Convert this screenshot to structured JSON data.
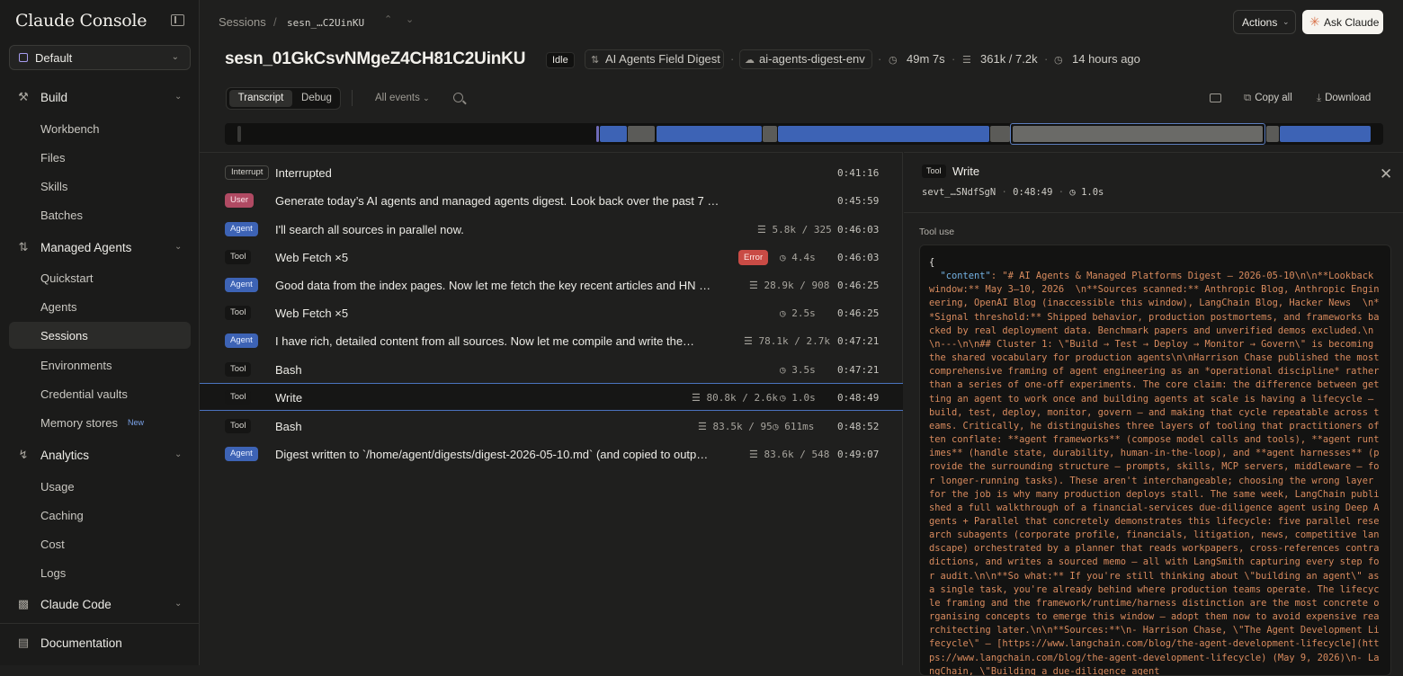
{
  "sidebar": {
    "brand": "Claude Console",
    "workspace": "Default",
    "sections": [
      {
        "label": "Build",
        "icon": "hammer-icon"
      },
      {
        "label": "Managed Agents",
        "icon": "agents-icon"
      },
      {
        "label": "Analytics",
        "icon": "bolt-icon"
      },
      {
        "label": "Claude Code",
        "icon": "terminal-icon"
      }
    ],
    "build_items": [
      "Workbench",
      "Files",
      "Skills",
      "Batches"
    ],
    "agents_items": [
      "Quickstart",
      "Agents",
      "Sessions",
      "Environments",
      "Credential vaults",
      "Memory stores"
    ],
    "memory_badge": "New",
    "analytics_items": [
      "Usage",
      "Caching",
      "Cost",
      "Logs"
    ],
    "documentation": "Documentation",
    "active_item": "Sessions"
  },
  "topbar": {
    "crumb_root": "Sessions",
    "crumb_current": "sesn_…C2UinKU",
    "actions_label": "Actions",
    "ask_label": "Ask Claude"
  },
  "session": {
    "id": "sesn_01GkCsvNMgeZ4CH81C2UinKU",
    "status": "Idle",
    "agent_name": "AI Agents Field Digest",
    "environment": "ai-agents-digest-env",
    "duration": "49m 7s",
    "tokens": "361k / 7.2k",
    "when": "14 hours ago"
  },
  "toolbar": {
    "tabs": [
      "Transcript",
      "Debug"
    ],
    "filter": "All events",
    "copy_all": "Copy all",
    "download": "Download"
  },
  "timeline": {
    "colors": {
      "agent": "#3d63b5",
      "tool": "#5b5b58",
      "interrupt": "#6e6ab8"
    }
  },
  "events": [
    {
      "tag": "Interrupt",
      "kind": "interrupt",
      "text": "Interrupted",
      "tokens": "",
      "duration": "",
      "time": "0:41:16"
    },
    {
      "tag": "User",
      "kind": "user",
      "text": "Generate today’s AI agents and managed agents digest. Look back over the past 7 …",
      "tokens": "",
      "duration": "",
      "time": "0:45:59"
    },
    {
      "tag": "Agent",
      "kind": "agent",
      "text": "I'll search all sources in parallel now.",
      "tokens": "5.8k / 325",
      "duration": "",
      "time": "0:46:03"
    },
    {
      "tag": "Tool",
      "kind": "tool",
      "text": "Web Fetch ×5",
      "tokens": "",
      "duration": "4.4s",
      "error": "Error",
      "time": "0:46:03"
    },
    {
      "tag": "Agent",
      "kind": "agent",
      "text": "Good data from the index pages. Now let me fetch the key recent articles and HN …",
      "tokens": "28.9k / 908",
      "duration": "",
      "time": "0:46:25"
    },
    {
      "tag": "Tool",
      "kind": "tool",
      "text": "Web Fetch ×5",
      "tokens": "",
      "duration": "2.5s",
      "time": "0:46:25"
    },
    {
      "tag": "Agent",
      "kind": "agent",
      "text": "I have rich, detailed content from all sources. Now let me compile and write the…",
      "tokens": "78.1k / 2.7k",
      "duration": "",
      "time": "0:47:21"
    },
    {
      "tag": "Tool",
      "kind": "tool",
      "text": "Bash",
      "tokens": "",
      "duration": "3.5s",
      "time": "0:47:21"
    },
    {
      "tag": "Tool",
      "kind": "tool",
      "text": "Write",
      "tokens": "80.8k / 2.6k",
      "duration": "1.0s",
      "time": "0:48:49",
      "selected": true
    },
    {
      "tag": "Tool",
      "kind": "tool",
      "text": "Bash",
      "tokens": "83.5k / 95",
      "duration": "611ms",
      "time": "0:48:52"
    },
    {
      "tag": "Agent",
      "kind": "agent",
      "text": "Digest written to `/home/agent/digests/digest-2026-05-10.md` (and copied to outp…",
      "tokens": "83.6k / 548",
      "duration": "",
      "time": "0:49:07"
    }
  ],
  "detail": {
    "tag": "Tool",
    "title": "Write",
    "event_id": "sevt_…SNdfSgN",
    "time": "0:48:49",
    "duration": "1.0s",
    "section_label": "Tool use",
    "open_brace": "{",
    "key": "\"content\"",
    "content": ": \"# AI Agents & Managed Platforms Digest — 2026-05-10\\n\\n**Lookback window:** May 3–10, 2026  \\n**Sources scanned:** Anthropic Blog, Anthropic Engineering, OpenAI Blog (inaccessible this window), LangChain Blog, Hacker News  \\n**Signal threshold:** Shipped behavior, production postmortems, and frameworks backed by real deployment data. Benchmark papers and unverified demos excluded.\\n\\n---\\n\\n## Cluster 1: \\\"Build → Test → Deploy → Monitor → Govern\\\" is becoming the shared vocabulary for production agents\\n\\nHarrison Chase published the most comprehensive framing of agent engineering as an *operational discipline* rather than a series of one-off experiments. The core claim: the difference between getting an agent to work once and building agents at scale is having a lifecycle — build, test, deploy, monitor, govern — and making that cycle repeatable across teams. Critically, he distinguishes three layers of tooling that practitioners often conflate: **agent frameworks** (compose model calls and tools), **agent runtimes** (handle state, durability, human-in-the-loop), and **agent harnesses** (provide the surrounding structure — prompts, skills, MCP servers, middleware — for longer-running tasks). These aren't interchangeable; choosing the wrong layer for the job is why many production deploys stall. The same week, LangChain published a full walkthrough of a financial-services due-diligence agent using Deep Agents + Parallel that concretely demonstrates this lifecycle: five parallel research subagents (corporate profile, financials, litigation, news, competitive landscape) orchestrated by a planner that reads workpapers, cross-references contradictions, and writes a sourced memo — all with LangSmith capturing every step for audit.\\n\\n**So what:** If you're still thinking about \\\"building an agent\\\" as a single task, you're already behind where production teams operate. The lifecycle framing and the framework/runtime/harness distinction are the most concrete organising concepts to emerge this window — adopt them now to avoid expensive rearchitecting later.\\n\\n**Sources:**\\n- Harrison Chase, \\\"The Agent Development Lifecycle\\\" — [https://www.langchain.com/blog/the-agent-development-lifecycle](https://www.langchain.com/blog/the-agent-development-lifecycle) (May 9, 2026)\\n- LangChain, \\\"Building a due-diligence agent"
  }
}
